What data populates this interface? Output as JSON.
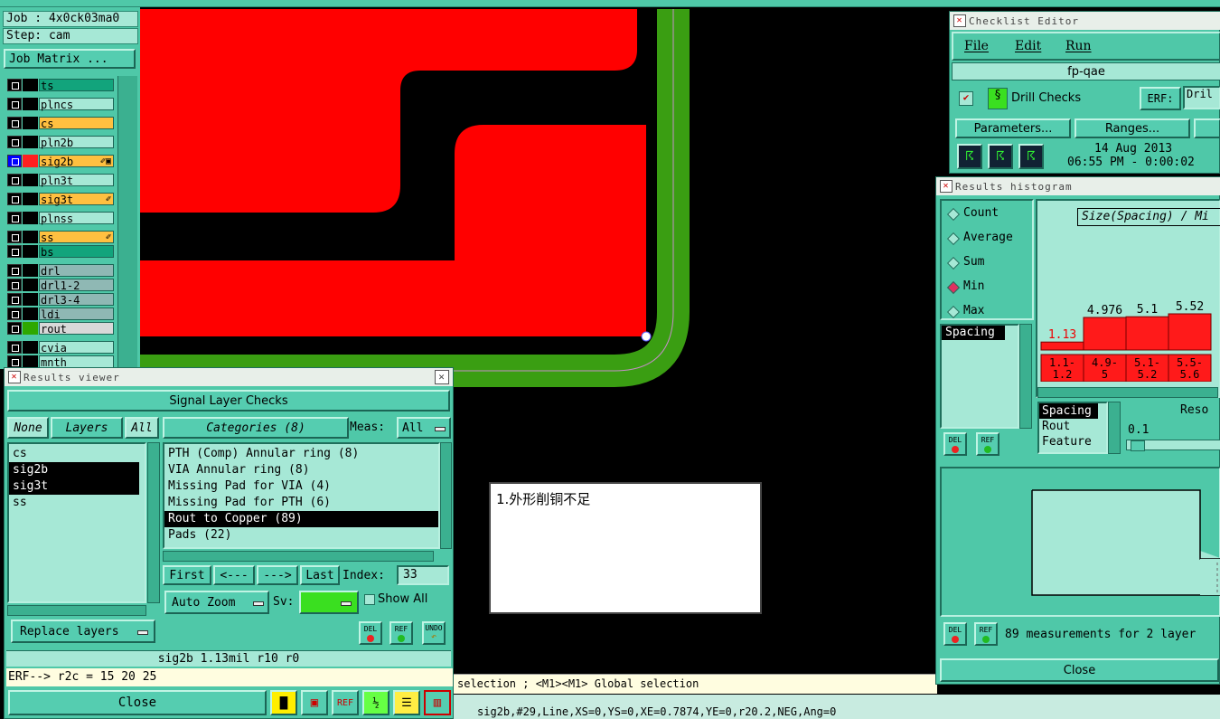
{
  "job_panel": {
    "job": "Job : 4x0ck03ma0",
    "step": "Step: cam",
    "job_matrix": "Job Matrix ...",
    "layers": [
      {
        "name": "ts",
        "bg": "#12a47c",
        "color": "#000"
      },
      {
        "name": "plncs",
        "bg": "#a6e8d6",
        "color": "#000"
      },
      {
        "name": "cs",
        "bg": "#ffc040",
        "color": "#000"
      },
      {
        "name": "pln2b",
        "bg": "#a6e8d6",
        "color": "#000"
      },
      {
        "name": "sig2b",
        "bg": "#ffc040",
        "color": "#ff2020",
        "suffix": "✐▣"
      },
      {
        "name": "pln3t",
        "bg": "#a6e8d6",
        "color": "#000"
      },
      {
        "name": "sig3t",
        "bg": "#ffc040",
        "color": "#000",
        "suffix": "✐"
      },
      {
        "name": "plnss",
        "bg": "#a6e8d6",
        "color": "#000"
      },
      {
        "name": "ss",
        "bg": "#ffc040",
        "color": "#000",
        "suffix": "✐"
      },
      {
        "name": "bs",
        "bg": "#12a47c",
        "color": "#000"
      },
      {
        "name": "drl",
        "bg": "#8fb8b4",
        "color": "#000"
      },
      {
        "name": "drl1-2",
        "bg": "#8fb8b4",
        "color": "#000"
      },
      {
        "name": "drl3-4",
        "bg": "#8fb8b4",
        "color": "#000"
      },
      {
        "name": "ldi",
        "bg": "#8fb8b4",
        "color": "#000"
      },
      {
        "name": "rout",
        "bg": "#d8d8d8",
        "color": "#2ea800"
      },
      {
        "name": "cvia",
        "bg": "#a6e8d6",
        "color": "#000"
      },
      {
        "name": "mnth",
        "bg": "#a6e8d6",
        "color": "#000"
      }
    ]
  },
  "results_viewer": {
    "title": "Results viewer",
    "header": "Signal Layer Checks",
    "none_btn": "None",
    "layers_btn": "Layers",
    "all_btn": "All",
    "categories_btn": "Categories (8)",
    "meas_label": "Meas:",
    "meas_value": "All",
    "layer_list": [
      "cs",
      "sig2b",
      "sig3t",
      "ss"
    ],
    "layer_selected": [
      "sig2b",
      "sig3t"
    ],
    "categories": [
      "PTH (Comp) Annular ring (8)",
      "VIA Annular ring (8)",
      "Missing Pad for VIA (4)",
      "Missing Pad for PTH (6)",
      "Rout to Copper (89)",
      "Pads (22)"
    ],
    "category_selected": "Rout to Copper (89)",
    "first": "First",
    "prev": "<---",
    "next": "--->",
    "last": "Last",
    "index_label": "Index:",
    "index_value": "33",
    "auto_zoom": "Auto Zoom",
    "sv_label": "Sv:",
    "show_all": "Show All",
    "replace_layers": "Replace layers",
    "del": "DEL",
    "ref": "REF",
    "undo": "UNDO",
    "status": "sig2b 1.13mil  r10  r0",
    "erf": "ERF--> r2c = 15 20 25",
    "close": "Close"
  },
  "note_box": {
    "text": "1.外形削铜不足"
  },
  "status_line_1": "selection ; <M1><M1> Global selection",
  "status_line_2": "sig2b,#29,Line,XS=0,YS=0,XE=0.7874,YE=0,r20.2,NEG,Ang=0",
  "checklist_editor": {
    "title": "Checklist Editor",
    "menu": [
      "File",
      "Edit",
      "Run"
    ],
    "checklist_name": "fp-qae",
    "drill_checks": "Drill Checks",
    "erf_label": "ERF:",
    "erf_value": "Dril",
    "parameters": "Parameters...",
    "ranges": "Ranges...",
    "date": "14 Aug 2013",
    "time": "06:55 PM - 0:00:02"
  },
  "histogram": {
    "title": "Results histogram",
    "radio_options": [
      "Count",
      "Average",
      "Sum",
      "Min",
      "Max"
    ],
    "radio_selected": "Min",
    "chart_title": "Size(Spacing) / Mi",
    "list_item": "Spacing",
    "bars": [
      {
        "value": "1.13",
        "height": 0.22,
        "range": "1.1-\n1.2"
      },
      {
        "value": "4.976",
        "height": 0.9,
        "range": "4.9-\n5"
      },
      {
        "value": "5.1",
        "height": 0.92,
        "range": "5.1-\n5.2"
      },
      {
        "value": "5.52",
        "height": 1.0,
        "range": "5.5-\n5.6"
      }
    ],
    "measure_list": [
      "Spacing",
      "Rout",
      "Feature"
    ],
    "measure_selected": "Spacing",
    "reso_label": "Reso",
    "reso_value": "0.1",
    "measurements": "89 measurements for 2 layer",
    "close": "Close"
  }
}
